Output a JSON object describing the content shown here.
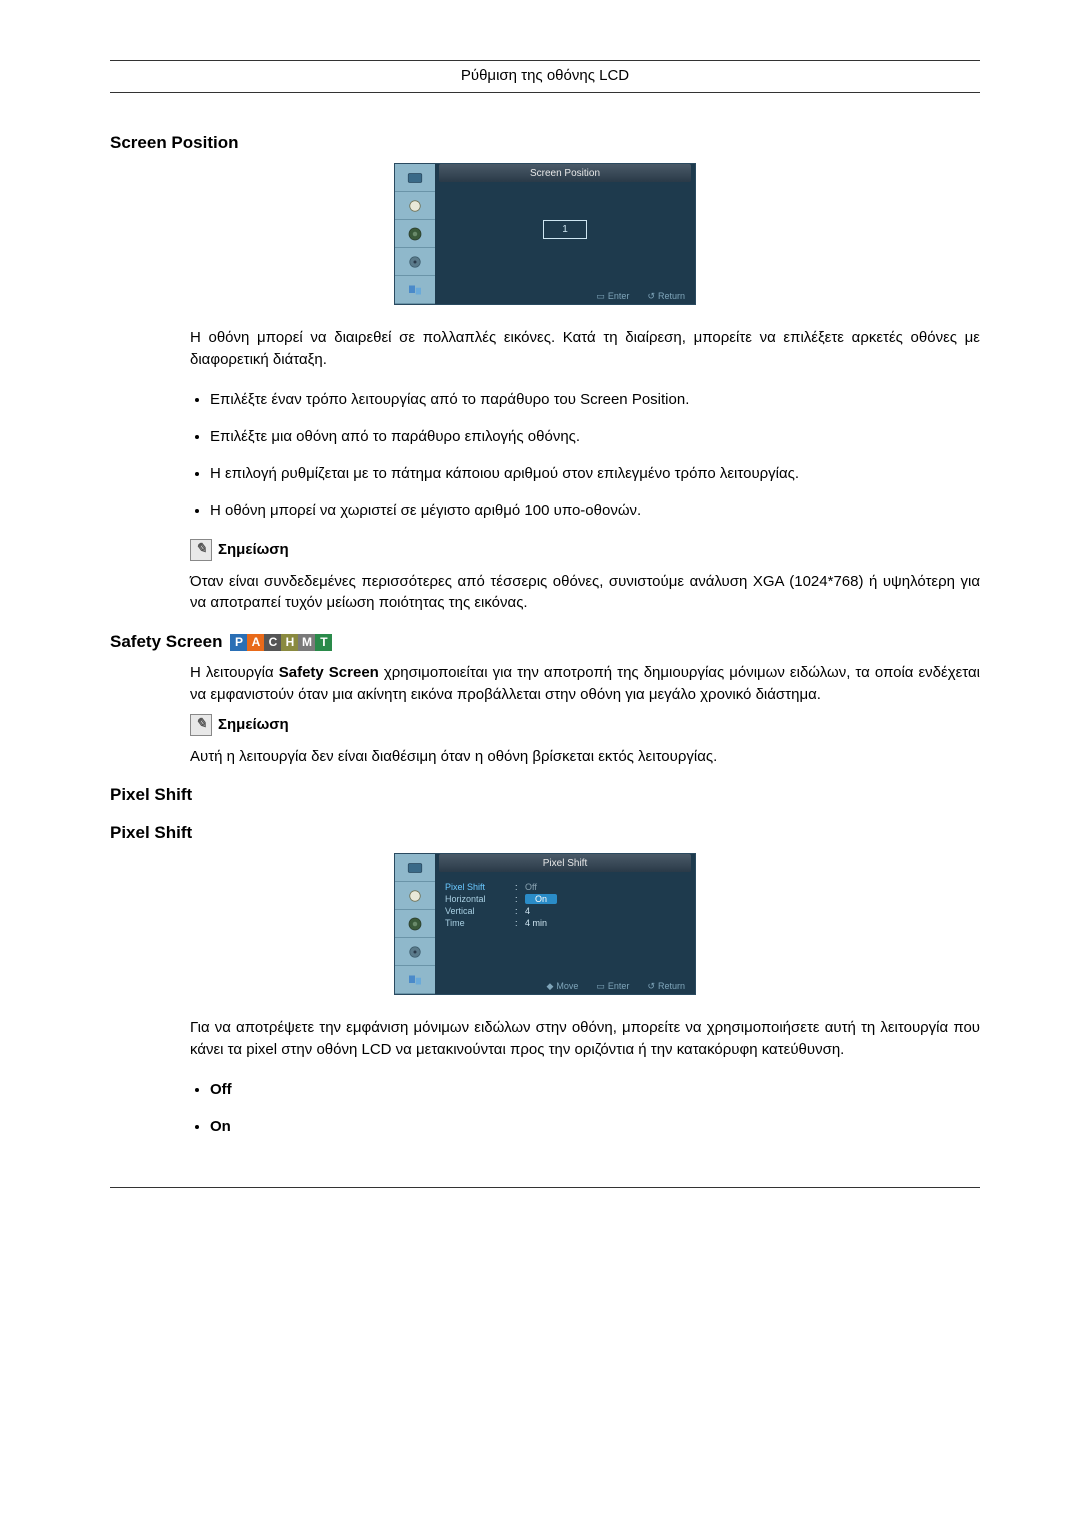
{
  "header": "Ρύθμιση της οθόνης LCD",
  "section1": {
    "title": "Screen Position",
    "osd_title": "Screen Position",
    "osd_value": "1",
    "osd_foot_enter": "Enter",
    "osd_foot_return": "Return",
    "intro": "H οθόνη μπορεί να διαιρεθεί σε πολλαπλές εικόνες. Κατά τη διαίρεση, μπορείτε να επιλέξετε αρκετές οθόνες με διαφορετική διάταξη.",
    "bullets": [
      "Επιλέξτε έναν τρόπο λειτουργίας από το παράθυρο του Screen Position.",
      "Επιλέξτε μια οθόνη από το παράθυρο επιλογής οθόνης.",
      "Η επιλογή ρυθμίζεται με το πάτημα κάποιου αριθμού στον επιλεγμένο τρόπο λειτουργίας.",
      "H οθόνη μπορεί να χωριστεί σε μέγιστο αριθμό 100 υπο-οθονών."
    ],
    "bullet0_bold": "Screen Position",
    "note_label": "Σημείωση",
    "note_text": "Όταν είναι συνδεδεμένες περισσότερες από τέσσερις οθόνες, συνιστούμε ανάλυση XGA (1024*768) ή υψηλότερη για να αποτραπεί τυχόν μείωση ποιότητας της εικόνας."
  },
  "section2": {
    "title": "Safety Screen",
    "para": "H λειτουργία Safety Screen χρησιμοποιείται για την αποτροπή της δημιουργίας μόνιμων ειδώλων, τα οποία ενδέχεται να εμφανιστούν όταν μια ακίνητη εικόνα προβάλλεται στην οθόνη για μεγάλο χρονικό διάστημα.",
    "para_bold": "Safety Screen",
    "note_label": "Σημείωση",
    "note_text": "Αυτή η λειτουργία δεν είναι διαθέσιμη όταν η οθόνη βρίσκεται εκτός λειτουργίας."
  },
  "section3": {
    "title1": "Pixel Shift",
    "title2": "Pixel Shift",
    "osd_title": "Pixel Shift",
    "rows": {
      "r0_label": "Pixel Shift",
      "r0_val_off": "Off",
      "r0_val_on": "On",
      "r1_label": "Horizontal",
      "r1_val": "",
      "r2_label": "Vertical",
      "r2_val": "4",
      "r3_label": "Time",
      "r3_val": "4 min"
    },
    "osd_foot_move": "Move",
    "osd_foot_enter": "Enter",
    "osd_foot_return": "Return",
    "para": "Για να αποτρέψετε την εμφάνιση μόνιμων ειδώλων στην οθόνη, μπορείτε να χρησιμοποιήσετε αυτή τη λειτουργία που κάνει τα pixel στην οθόνη LCD να μετακινούνται προς την οριζόντια ή την κατακόρυφη κατεύθυνση.",
    "bullets": [
      "Off",
      "On"
    ]
  }
}
